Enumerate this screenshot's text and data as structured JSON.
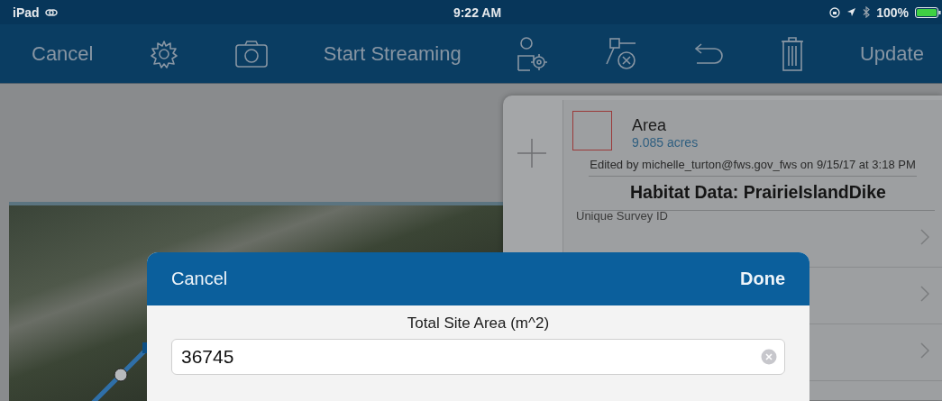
{
  "status_bar": {
    "device": "iPad",
    "time": "9:22 AM",
    "battery": "100%"
  },
  "toolbar": {
    "cancel": "Cancel",
    "stream": "Start Streaming",
    "update": "Update"
  },
  "feature": {
    "title": "Area",
    "measure": "9.085 acres",
    "edited": "Edited by michelle_turton@fws.gov_fws on 9/15/17 at 3:18 PM",
    "heading": "Habitat Data: PrairieIslandDike",
    "field_label": "Unique Survey ID"
  },
  "dialog": {
    "cancel": "Cancel",
    "done": "Done",
    "label": "Total Site Area (m^2)",
    "value": "36745"
  }
}
